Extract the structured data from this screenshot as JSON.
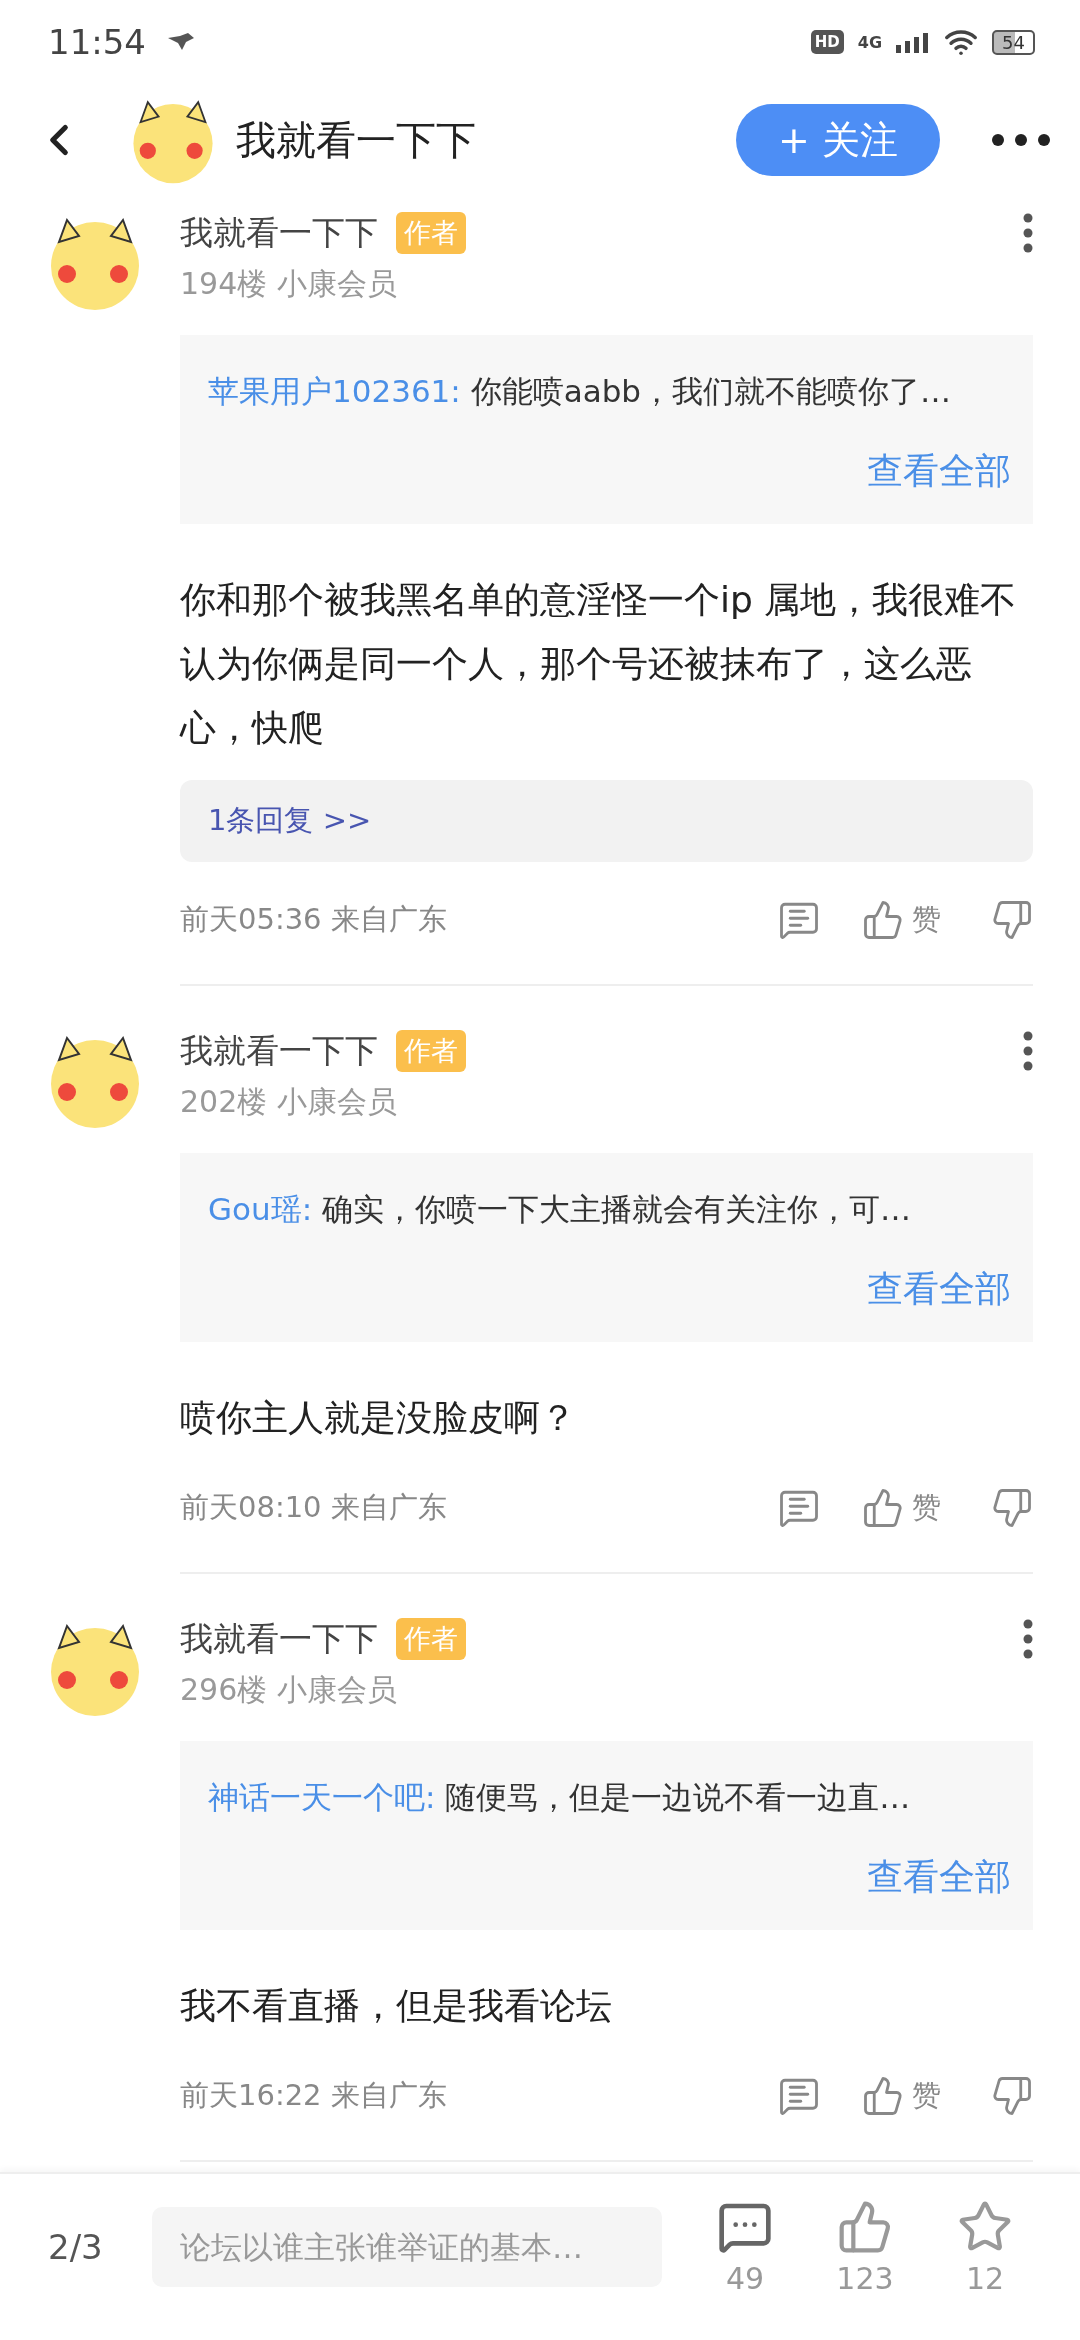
{
  "status_bar": {
    "time": "11:54",
    "hd": "HD",
    "network": "4G",
    "battery": "54"
  },
  "header": {
    "title": "我就看一下下",
    "follow_button": "+ 关注"
  },
  "posts": [
    {
      "author": "我就看一下下",
      "badge": "作者",
      "floor": "194楼",
      "member": "小康会员",
      "quote": {
        "user": "苹果用户102361:",
        "text": "你能喷aabb，我们就不能喷你了…",
        "link": "查看全部"
      },
      "body": "你和那个被我黑名单的意淫怪一个ip 属地，我很难不认为你俩是同一个人，那个号还被抹布了，这么恶心，快爬",
      "replies": "1条回复 >>",
      "time": "前天05:36 来自广东",
      "like_label": "赞"
    },
    {
      "author": "我就看一下下",
      "badge": "作者",
      "floor": "202楼",
      "member": "小康会员",
      "quote": {
        "user": "Gou瑶:",
        "text": "确实，你喷一下大主播就会有关注你，可…",
        "link": "查看全部"
      },
      "body": "喷你主人就是没脸皮啊？",
      "time": "前天08:10 来自广东",
      "like_label": "赞"
    },
    {
      "author": "我就看一下下",
      "badge": "作者",
      "floor": "296楼",
      "member": "小康会员",
      "quote": {
        "user": "神话一天一个吧:",
        "text": "随便骂，但是一边说不看一边直…",
        "link": "查看全部"
      },
      "body": "我不看直播，但是我看论坛",
      "time": "前天16:22 来自广东",
      "like_label": "赞"
    }
  ],
  "bottom_bar": {
    "page": "2/3",
    "input": {
      "placeholder": "论坛以谁主张谁举证的基本…"
    },
    "actions": [
      {
        "kind": "comment",
        "count": "49"
      },
      {
        "kind": "like",
        "count": "123"
      },
      {
        "kind": "star",
        "count": "12"
      }
    ]
  }
}
